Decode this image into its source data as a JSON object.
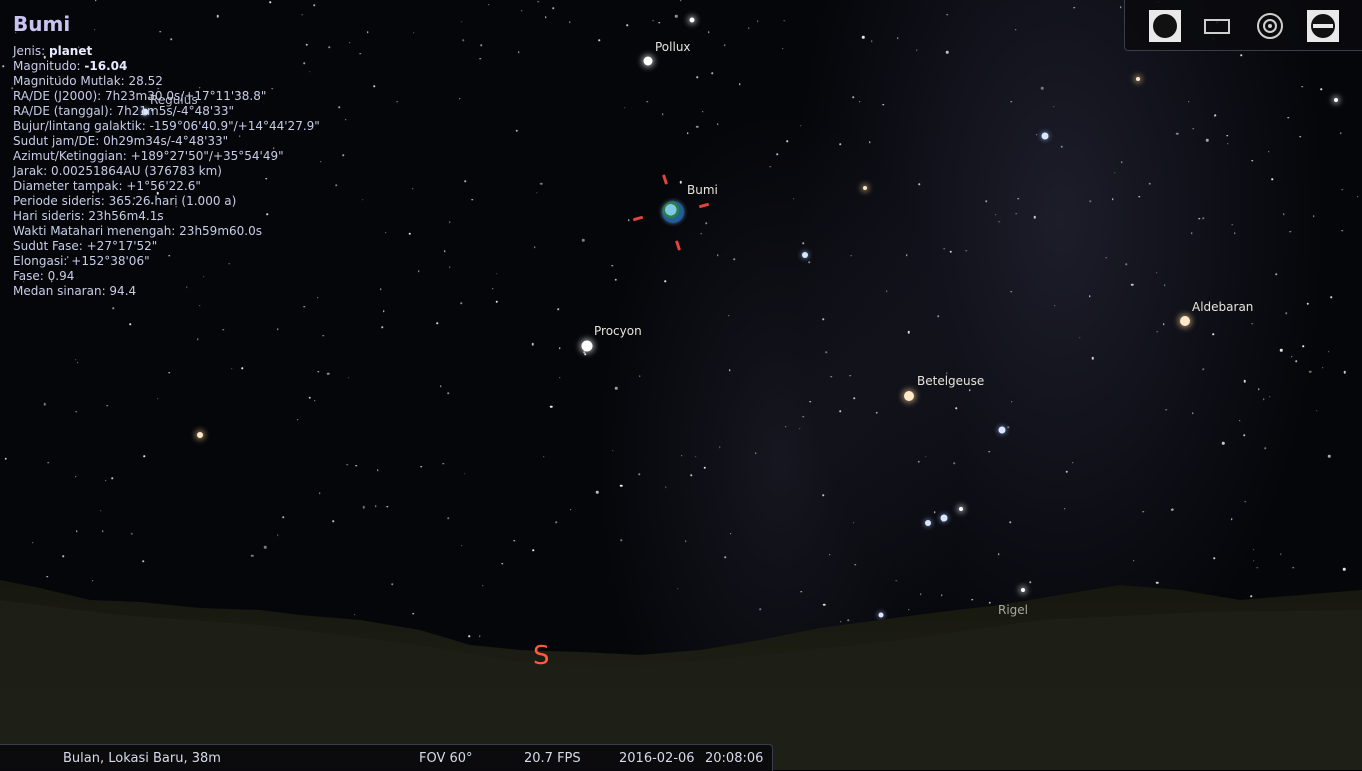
{
  "selected_object": {
    "name": "Bumi",
    "info_lines": [
      {
        "label": "Jenis: ",
        "value": "planet",
        "bold": true
      },
      {
        "label": "Magnitudo: ",
        "value": "-16.04",
        "bold": true
      },
      {
        "label": "Magnitudo Mutlak: ",
        "value": "28.52"
      },
      {
        "label": "RA/DE (J2000): ",
        "value": "7h23m30.0s/+17°11'38.8\""
      },
      {
        "label": "RA/DE (tanggal): ",
        "value": "7h21m5s/-4°48'33\""
      },
      {
        "label": "Bujur/lintang galaktik: ",
        "value": "-159°06'40.9\"/+14°44'27.9\""
      },
      {
        "label": "Sudut jam/DE: ",
        "value": "0h29m34s/-4°48'33\""
      },
      {
        "label": "Azimut/Ketinggian: ",
        "value": "+189°27'50\"/+35°54'49\""
      },
      {
        "label": "Jarak: ",
        "value": "0.00251864AU (376783 km)"
      },
      {
        "label": "Diameter tampak: ",
        "value": "+1°56'22.6\""
      },
      {
        "label": "Periode sideris: ",
        "value": "365.26 hari (1.000 a)"
      },
      {
        "label": "Hari sideris: ",
        "value": "23h56m4.1s"
      },
      {
        "label": "Wakti Matahari menengah: ",
        "value": "23h59m60.0s"
      },
      {
        "label": "Sudut Fase: ",
        "value": "+27°17'52\""
      },
      {
        "label": "Elongasi: ",
        "value": "+152°38'06\""
      },
      {
        "label": "Fase: ",
        "value": "0.94"
      },
      {
        "label": "Medan sinaran: ",
        "value": "94.4"
      }
    ]
  },
  "star_labels": {
    "pollux": "Pollux",
    "bumi": "Bumi",
    "procyon": "Procyon",
    "betelgeuse": "Betelgeuse",
    "aldebaran": "Aldebaran",
    "rigel": "Rigel",
    "regulus": "Regulus"
  },
  "cardinal": {
    "south": "S"
  },
  "toolbar": {
    "buttons": [
      {
        "name": "night-mode-icon"
      },
      {
        "name": "fullscreen-icon"
      },
      {
        "name": "target-icon"
      },
      {
        "name": "telescope-icon"
      }
    ]
  },
  "status_bar": {
    "location": "Bulan, Lokasi Baru, 38m",
    "fov": "FOV 60°",
    "fps": "20.7 FPS",
    "date": "2016-02-06",
    "time": "20:08:06"
  },
  "colors": {
    "marker": "#e0453a",
    "cardinal": "#ff5a3c",
    "title": "#c8c4f0"
  }
}
